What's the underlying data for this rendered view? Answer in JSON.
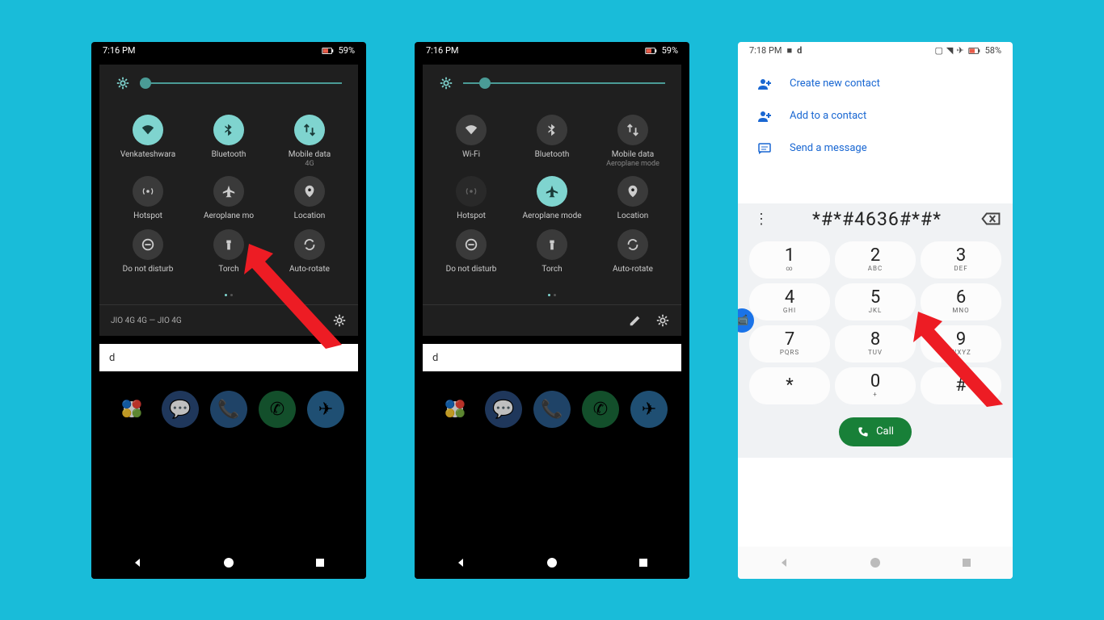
{
  "phone1": {
    "time": "7:16 PM",
    "battery": "59%",
    "tiles": [
      {
        "label": "Venkateshwara",
        "icon": "wifi",
        "active": true
      },
      {
        "label": "Bluetooth",
        "icon": "bluetooth",
        "active": true
      },
      {
        "label": "Mobile data",
        "sublabel": "4G",
        "icon": "data",
        "active": true
      },
      {
        "label": "Hotspot",
        "icon": "hotspot",
        "active": false
      },
      {
        "label": "Aeroplane mo",
        "icon": "airplane",
        "active": false
      },
      {
        "label": "Location",
        "icon": "location",
        "active": false
      },
      {
        "label": "Do not disturb",
        "icon": "dnd",
        "active": false
      },
      {
        "label": "Torch",
        "icon": "torch",
        "active": false
      },
      {
        "label": "Auto-rotate",
        "icon": "rotate",
        "active": false
      }
    ],
    "carrier": "JIO 4G 4G — JIO 4G",
    "search": "d"
  },
  "phone2": {
    "time": "7:16 PM",
    "battery": "59%",
    "tiles": [
      {
        "label": "Wi-Fi",
        "icon": "wifi",
        "active": false
      },
      {
        "label": "Bluetooth",
        "icon": "bluetooth",
        "active": false
      },
      {
        "label": "Mobile data",
        "sublabel": "Aeroplane mode",
        "icon": "data",
        "active": false
      },
      {
        "label": "Hotspot",
        "icon": "hotspot",
        "active": false,
        "disabled": true
      },
      {
        "label": "Aeroplane mode",
        "icon": "airplane",
        "active": true
      },
      {
        "label": "Location",
        "icon": "location",
        "active": false
      },
      {
        "label": "Do not disturb",
        "icon": "dnd",
        "active": false
      },
      {
        "label": "Torch",
        "icon": "torch",
        "active": false
      },
      {
        "label": "Auto-rotate",
        "icon": "rotate",
        "active": false
      }
    ],
    "carrier": "",
    "search": "d"
  },
  "phone3": {
    "time": "7:18 PM",
    "battery": "58%",
    "actions": [
      {
        "label": "Create new contact",
        "icon": "person-add"
      },
      {
        "label": "Add to a contact",
        "icon": "person-add"
      },
      {
        "label": "Send a message",
        "icon": "message"
      }
    ],
    "number": "*#*#4636#*#*",
    "keys": [
      {
        "d": "1",
        "l": "∞"
      },
      {
        "d": "2",
        "l": "ABC"
      },
      {
        "d": "3",
        "l": "DEF"
      },
      {
        "d": "4",
        "l": "GHI"
      },
      {
        "d": "5",
        "l": "JKL"
      },
      {
        "d": "6",
        "l": "MNO"
      },
      {
        "d": "7",
        "l": "PQRS"
      },
      {
        "d": "8",
        "l": "TUV"
      },
      {
        "d": "9",
        "l": "WXYZ"
      },
      {
        "d": "*",
        "l": ""
      },
      {
        "d": "0",
        "l": "+"
      },
      {
        "d": "#",
        "l": ""
      }
    ],
    "call_label": "Call"
  }
}
